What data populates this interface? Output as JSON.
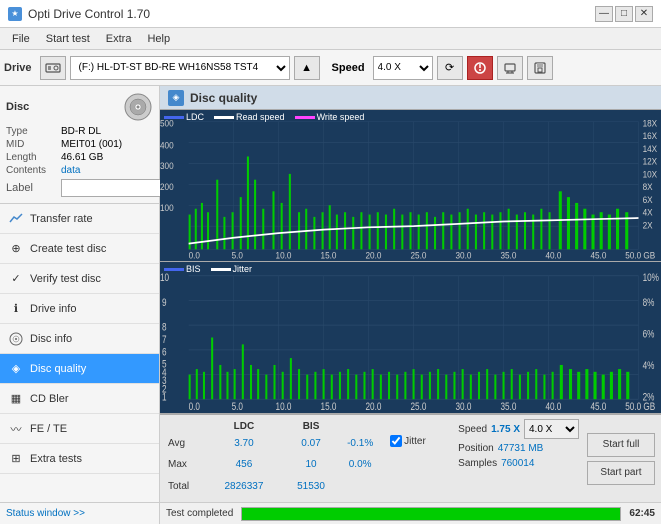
{
  "app": {
    "title": "Opti Drive Control 1.70",
    "icon": "★"
  },
  "titlebar": {
    "title": "Opti Drive Control 1.70",
    "minimize": "—",
    "maximize": "□",
    "close": "✕"
  },
  "menubar": {
    "items": [
      "File",
      "Start test",
      "Extra",
      "Help"
    ]
  },
  "toolbar": {
    "drive_label": "Drive",
    "drive_value": "(F:) HL-DT-ST BD-RE  WH16NS58 TST4",
    "speed_label": "Speed",
    "speed_value": "4.0 X"
  },
  "disc": {
    "title": "Disc",
    "type_label": "Type",
    "type_value": "BD-R DL",
    "mid_label": "MID",
    "mid_value": "MEIT01 (001)",
    "length_label": "Length",
    "length_value": "46.61 GB",
    "contents_label": "Contents",
    "contents_value": "data",
    "label_label": "Label"
  },
  "nav": {
    "items": [
      {
        "id": "transfer-rate",
        "label": "Transfer rate",
        "icon": "↗"
      },
      {
        "id": "create-test-disc",
        "label": "Create test disc",
        "icon": "⊕"
      },
      {
        "id": "verify-test-disc",
        "label": "Verify test disc",
        "icon": "✓"
      },
      {
        "id": "drive-info",
        "label": "Drive info",
        "icon": "ℹ"
      },
      {
        "id": "disc-info",
        "label": "Disc info",
        "icon": "💿"
      },
      {
        "id": "disc-quality",
        "label": "Disc quality",
        "icon": "◈",
        "active": true
      },
      {
        "id": "cd-bler",
        "label": "CD Bler",
        "icon": "▦"
      },
      {
        "id": "fe-te",
        "label": "FE / TE",
        "icon": "〰"
      },
      {
        "id": "extra-tests",
        "label": "Extra tests",
        "icon": "⊞"
      }
    ]
  },
  "content": {
    "title": "Disc quality",
    "chart1": {
      "legend": [
        "LDC",
        "Read speed",
        "Write speed"
      ],
      "y_max": 500,
      "y_axis_right": [
        "18X",
        "16X",
        "14X",
        "12X",
        "10X",
        "8X",
        "6X",
        "4X",
        "2X"
      ],
      "x_axis": [
        "0.0",
        "5.0",
        "10.0",
        "15.0",
        "20.0",
        "25.0",
        "30.0",
        "35.0",
        "40.0",
        "45.0",
        "50.0 GB"
      ]
    },
    "chart2": {
      "legend": [
        "BIS",
        "Jitter"
      ],
      "y_max": 10,
      "y_axis_right": [
        "10%",
        "8%",
        "6%",
        "4%",
        "2%"
      ],
      "x_axis": [
        "0.0",
        "5.0",
        "10.0",
        "15.0",
        "20.0",
        "25.0",
        "30.0",
        "35.0",
        "40.0",
        "45.0",
        "50.0 GB"
      ]
    }
  },
  "stats": {
    "columns": [
      "",
      "LDC",
      "BIS",
      "",
      "Jitter",
      "Speed",
      "",
      ""
    ],
    "avg_label": "Avg",
    "avg_ldc": "3.70",
    "avg_bis": "0.07",
    "avg_jitter": "-0.1%",
    "max_label": "Max",
    "max_ldc": "456",
    "max_bis": "10",
    "max_jitter": "0.0%",
    "total_label": "Total",
    "total_ldc": "2826337",
    "total_bis": "51530",
    "speed_label": "Speed",
    "speed_value": "1.75 X",
    "speed_dropdown": "4.0 X",
    "position_label": "Position",
    "position_value": "47731 MB",
    "samples_label": "Samples",
    "samples_value": "760014",
    "jitter_checked": true,
    "start_full": "Start full",
    "start_part": "Start part"
  },
  "statusbar": {
    "status_window": "Status window >>",
    "status_text": "Test completed",
    "progress": 100,
    "time": "62:45"
  }
}
